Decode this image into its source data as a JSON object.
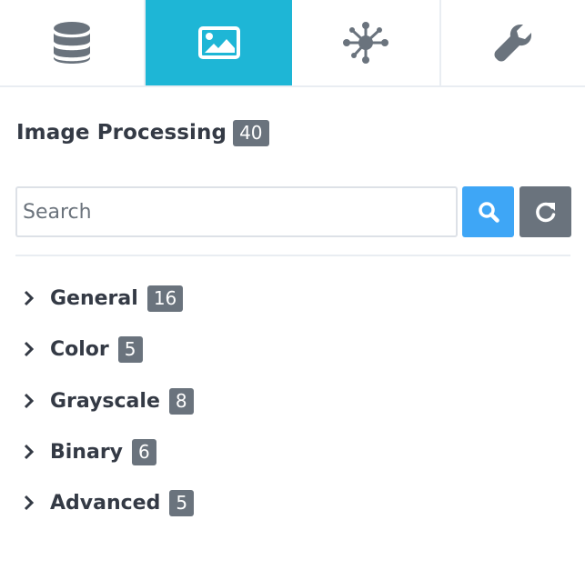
{
  "tabs": [
    {
      "icon": "database-icon",
      "active": false
    },
    {
      "icon": "image-icon",
      "active": true
    },
    {
      "icon": "network-nodes-icon",
      "active": false
    },
    {
      "icon": "wrench-icon",
      "active": false
    }
  ],
  "header": {
    "title": "Image Processing",
    "count": "40"
  },
  "search": {
    "placeholder": "Search",
    "value": "",
    "search_icon": "search-icon",
    "refresh_icon": "refresh-icon"
  },
  "categories": [
    {
      "label": "General",
      "count": "16"
    },
    {
      "label": "Color",
      "count": "5"
    },
    {
      "label": "Grayscale",
      "count": "8"
    },
    {
      "label": "Binary",
      "count": "6"
    },
    {
      "label": "Advanced",
      "count": "5"
    }
  ],
  "colors": {
    "accent": "#1eb6d6",
    "search_button": "#3ea6f6",
    "badge": "#6a737d",
    "text": "#343a45"
  }
}
